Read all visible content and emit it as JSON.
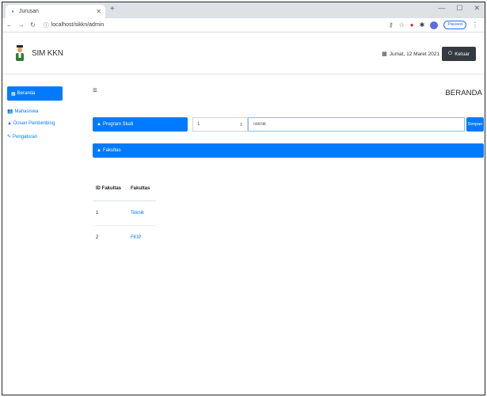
{
  "browser": {
    "tab_title": "Jurusan",
    "url": "localhost/sikkn/admin",
    "profile_label": "Paused",
    "icons": {
      "favicon": "document-icon",
      "close": "close-icon",
      "new_tab": "plus-icon",
      "minimize": "minimize-icon",
      "maximize": "maximize-icon",
      "window_close": "window-close-icon",
      "back": "back-arrow-icon",
      "forward": "forward-arrow-icon",
      "reload": "reload-icon",
      "lock": "info-icon",
      "extensions": [
        "key-icon",
        "star-icon",
        "extension-icon",
        "puzzle-icon"
      ],
      "menu": "kebab-menu-icon"
    }
  },
  "header": {
    "brand": "SIM KKN",
    "date_text": "Jumat, 12 Maret 2021",
    "logout_label": "Keluar",
    "icons": {
      "logo": "student-avatar-icon",
      "calendar": "calendar-icon",
      "logout": "power-icon"
    }
  },
  "sidebar": {
    "items": [
      {
        "label": "Beranda",
        "icon": "dashboard-icon",
        "active": true
      },
      {
        "label": "Mahasiswa",
        "icon": "users-icon",
        "active": false
      },
      {
        "label": "Dosen Pembimbing",
        "icon": "user-tie-icon",
        "active": false
      },
      {
        "label": "Pengaturan",
        "icon": "pencil-icon",
        "active": false
      }
    ]
  },
  "main": {
    "page_title": "BERANDA",
    "filter": {
      "program_label": "Program Studi",
      "select_value": "1",
      "search_value": "Teknik",
      "search_button": "Simpan"
    },
    "detail_label": "Fakultas",
    "table": {
      "columns": [
        "ID Fakultas",
        "Fakultas"
      ],
      "rows": [
        {
          "id": "1",
          "name": "Teknik"
        },
        {
          "id": "2",
          "name": "FKIP"
        }
      ]
    }
  },
  "colors": {
    "accent": "#007bff",
    "dark_button": "#343a40",
    "chrome_bg": "#dee1e6"
  }
}
